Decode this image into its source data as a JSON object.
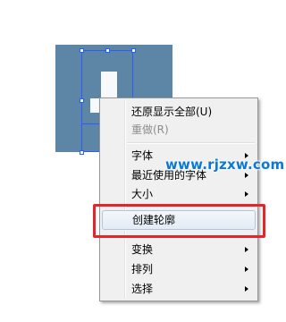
{
  "canvas": {
    "artwork_color": "#5d86a6",
    "selection_color": "#2b5cff"
  },
  "watermark": {
    "text": "www.rjzxw.com",
    "color": "#0a78d6"
  },
  "context_menu": {
    "items": [
      {
        "label": "还原显示全部(U)",
        "enabled": true,
        "submenu": false
      },
      {
        "label": "重做(R)",
        "enabled": false,
        "submenu": false
      },
      {
        "label": "字体",
        "enabled": true,
        "submenu": true
      },
      {
        "label": "最近使用的字体",
        "enabled": true,
        "submenu": true
      },
      {
        "label": "大小",
        "enabled": true,
        "submenu": true
      },
      {
        "label": "创建轮廓",
        "enabled": true,
        "submenu": false,
        "highlighted": true
      },
      {
        "label": "变换",
        "enabled": true,
        "submenu": true
      },
      {
        "label": "排列",
        "enabled": true,
        "submenu": true
      },
      {
        "label": "选择",
        "enabled": true,
        "submenu": true
      }
    ]
  },
  "annotation": {
    "color": "#e2262b",
    "target": "创建轮廓"
  }
}
